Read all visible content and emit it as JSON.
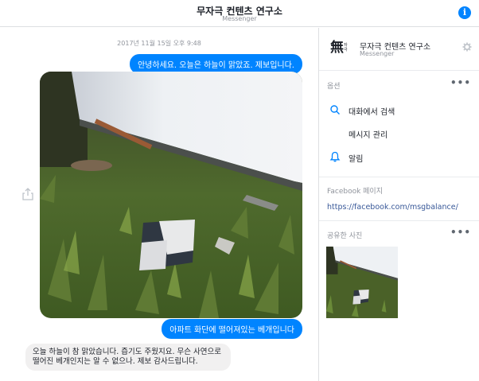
{
  "header": {
    "title": "무자극 컨텐츠 연구소",
    "subtitle": "Messenger",
    "info_icon": "info-icon"
  },
  "chat": {
    "timestamp": "2017년 11월 15일 오후 9:48",
    "messages": [
      {
        "from": "me",
        "text": "안녕하세요. 오늘은 하늘이 맑았죠. 제보입니다."
      },
      {
        "from": "me",
        "type": "photo"
      },
      {
        "from": "me",
        "text": "아파트 화단에 떨어져있는 베개입니다"
      },
      {
        "from": "page",
        "text": "오늘 하늘이 참 맑았습니다. 즙기도 주웠지요. 무슨 사연으로 떨어진 베개인지는 알 수 없으나. 제보 감사드립니다."
      }
    ]
  },
  "sidebar": {
    "name": "무자극 컨텐츠 연구소",
    "sub": "Messenger",
    "logo_text": "無",
    "logo_text_small": "자극",
    "options_title": "옵션",
    "options": [
      {
        "label": "대화에서 검색",
        "icon": "search-icon"
      },
      {
        "label": "메시지 관리",
        "icon": ""
      },
      {
        "label": "알림",
        "icon": "bell-icon"
      }
    ],
    "facebook_title": "Facebook 페이지",
    "facebook_url": "https://facebook.com/msgbalance/",
    "shared_title": "공유한 사진",
    "more": "•••"
  },
  "colors": {
    "accent": "#0084ff",
    "bubble_in": "#f1f0f0",
    "link": "#385898",
    "muted": "#90949c"
  }
}
